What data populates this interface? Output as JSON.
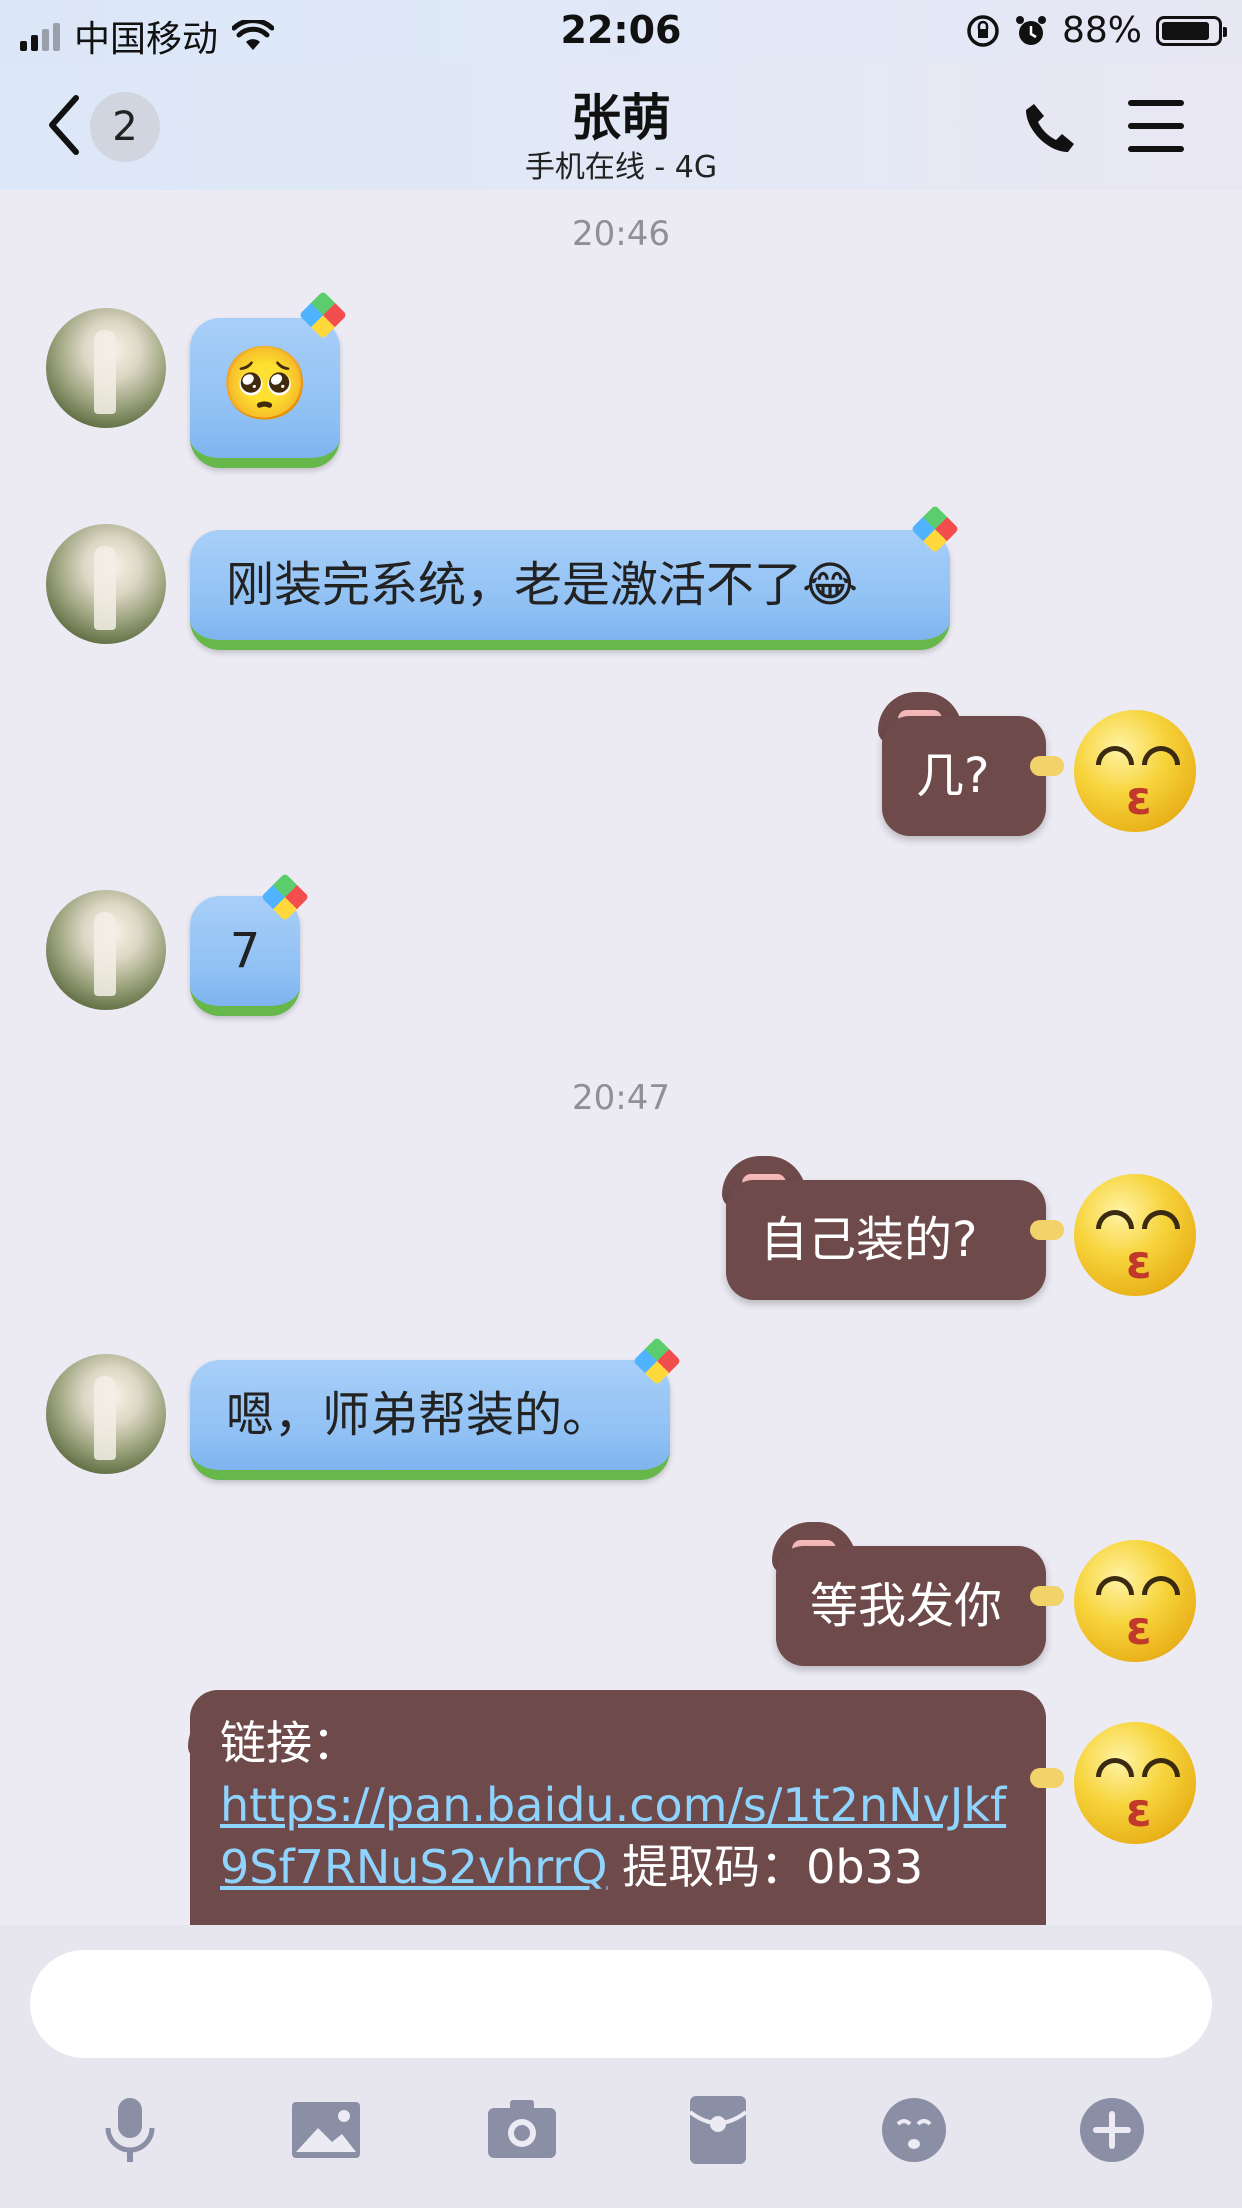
{
  "status_bar": {
    "carrier": "中国移动",
    "time": "22:06",
    "battery": "88%",
    "icons": [
      "signal-icon",
      "wifi-icon",
      "rotation-lock-icon",
      "alarm-icon",
      "battery-icon"
    ]
  },
  "nav": {
    "back_icon": "chevron-left-icon",
    "unread_count": "2",
    "contact_name": "张萌",
    "contact_status": "手机在线 - 4G",
    "call_icon": "phone-icon",
    "menu_icon": "menu-icon"
  },
  "chat": {
    "timestamps": [
      "20:46",
      "20:47"
    ],
    "messages": [
      {
        "side": "left",
        "text": "🥺",
        "type": "emoji"
      },
      {
        "side": "left",
        "text": "刚装完系统，老是激活不了😂"
      },
      {
        "side": "right",
        "text": "几?"
      },
      {
        "side": "left",
        "text": "7"
      },
      {
        "side": "right",
        "text": "自己装的?"
      },
      {
        "side": "left",
        "text": "嗯，师弟帮装的。"
      },
      {
        "side": "right",
        "text": "等我发你"
      },
      {
        "side": "right",
        "label": "链接：",
        "url": "https://pan.baidu.com/s/1t2nNvJkf9Sf7RNuS2vhrrQ",
        "extra": "提取码：0b33"
      }
    ]
  },
  "input": {
    "placeholder": "",
    "tools": [
      "microphone-icon",
      "image-icon",
      "camera-icon",
      "red-packet-icon",
      "emoji-icon",
      "plus-icon"
    ]
  },
  "colors": {
    "chat_bg": "#eceaf3",
    "left_bubble": "#8fc0f4",
    "right_bubble": "#6e4a4b",
    "tool_icon": "#8a8fa6"
  }
}
